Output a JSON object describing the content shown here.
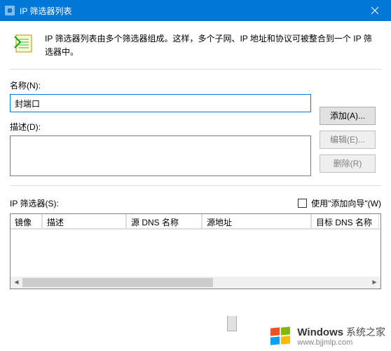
{
  "titlebar": {
    "title": "IP 筛选器列表"
  },
  "description": "IP 筛选器列表由多个筛选器组成。这样，多个子网、IP 地址和协议可被整合到一个 IP 筛选器中。",
  "nameField": {
    "label": "名称(N):",
    "value": "封端口"
  },
  "descField": {
    "label": "描述(D):",
    "value": ""
  },
  "buttons": {
    "add": "添加(A)...",
    "edit": "编辑(E)...",
    "remove": "删除(R)"
  },
  "filters": {
    "label": "IP 筛选器(S):",
    "wizard_label": "使用\"添加向导\"(W)",
    "columns": {
      "c1": "镜像",
      "c2": "描述",
      "c3": "源 DNS 名称",
      "c4": "源地址",
      "c5": "目标 DNS 名称"
    }
  },
  "watermark": {
    "brand": "Windows",
    "suffix": "系统之家",
    "url": "www.bjjmlp.com"
  }
}
